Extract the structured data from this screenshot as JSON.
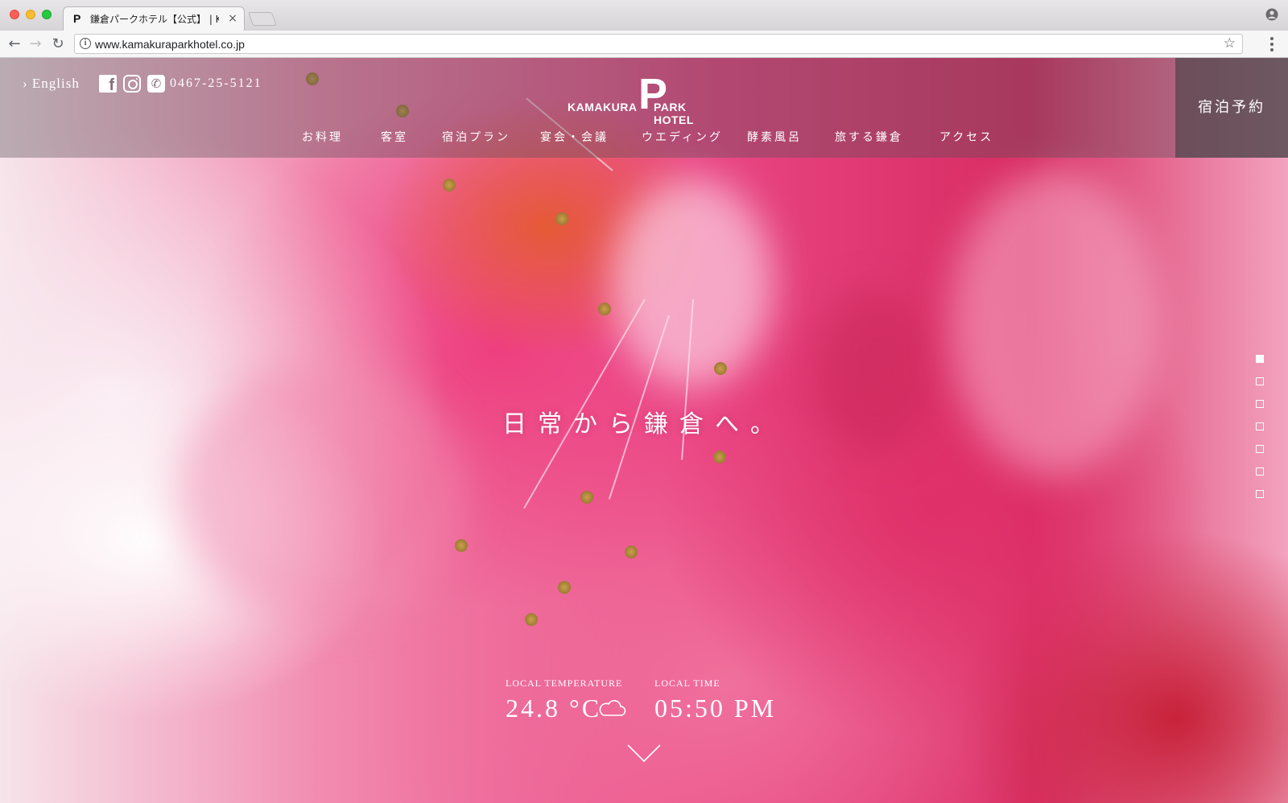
{
  "browser": {
    "tab_title": "鎌倉パークホテル【公式】 | KAMAKURA PARK HOTEL",
    "tab_favicon": "P",
    "tab_close": "×",
    "url": "www.kamakuraparkhotel.co.jp",
    "icons": [
      "back-arrow-icon",
      "forward-arrow-icon",
      "reload-icon",
      "info-icon",
      "star-icon",
      "profile-icon",
      "menu-icon"
    ]
  },
  "header": {
    "language_link": "English",
    "phone": "0467-25-5121",
    "logo_p": "P",
    "logo_left": "KAMAKURA",
    "logo_right": "PARK HOTEL",
    "reserve_button": "宿泊予約",
    "nav": [
      "お料理",
      "客室",
      "宿泊プラン",
      "宴会・会議",
      "ウエディング",
      "酵素風呂",
      "旅する鎌倉",
      "アクセス"
    ]
  },
  "hero": {
    "tagline": "日常から鎌倉へ。",
    "slides_total": 7,
    "active_slide": 1
  },
  "info": {
    "temperature_label": "LOCAL TEMPERATURE",
    "temperature_value": "24.8 °C",
    "weather_icon": "cloud-icon",
    "time_label": "LOCAL TIME",
    "time_value": "05:50 PM"
  },
  "colors": {
    "header_overlay": "#5a5058",
    "reserve_bg": "#50464c",
    "flower_primary": "#e94683",
    "flower_dark": "#c8223a"
  }
}
